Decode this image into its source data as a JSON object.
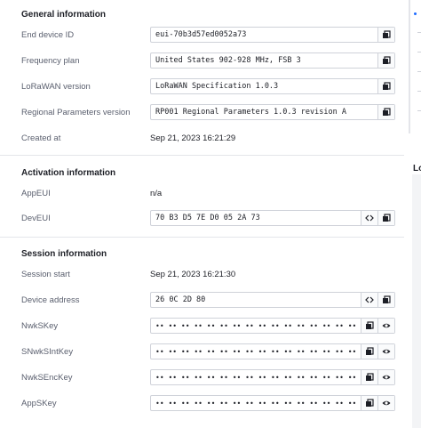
{
  "general": {
    "title": "General information",
    "rows": [
      {
        "label": "End device ID",
        "value": "eui-70b3d57ed0052a73"
      },
      {
        "label": "Frequency plan",
        "value": "United States 902-928 MHz, FSB 3"
      },
      {
        "label": "LoRaWAN version",
        "value": "LoRaWAN Specification 1.0.3"
      },
      {
        "label": "Regional Parameters version",
        "value": "RP001 Regional Parameters 1.0.3 revision A"
      },
      {
        "label": "Created at",
        "value": "Sep 21, 2023 16:21:29"
      }
    ]
  },
  "activation": {
    "title": "Activation information",
    "rows": [
      {
        "label": "AppEUI",
        "value": "n/a"
      },
      {
        "label": "DevEUI",
        "value": "70 B3 D5 7E D0 05 2A 73"
      }
    ]
  },
  "session": {
    "title": "Session information",
    "rows": [
      {
        "label": "Session start",
        "value": "Sep 21, 2023 16:21:30"
      },
      {
        "label": "Device address",
        "value": "26 0C 2D 80"
      },
      {
        "label": "NwkSKey",
        "value": "•• •• •• •• •• •• •• •• •• •• •• •• •• •• •• ••"
      },
      {
        "label": "SNwkSIntKey",
        "value": "•• •• •• •• •• •• •• •• •• •• •• •• •• •• •• ••"
      },
      {
        "label": "NwkSEncKey",
        "value": "•• •• •• •• •• •• •• •• •• •• •• •• •• •• •• ••"
      },
      {
        "label": "AppSKey",
        "value": "•• •• •• •• •• •• •• •• •• •• •• •• •• •• •• ••"
      }
    ]
  },
  "right_panel": {
    "cut_heading": "Lo"
  },
  "icons": {
    "copy": "copy-icon",
    "toggle_format": "code-toggle-icon",
    "show": "eye-icon"
  },
  "colors": {
    "accent": "#1d6bff",
    "label": "#5a5f6e",
    "border": "#cfd2d9"
  }
}
